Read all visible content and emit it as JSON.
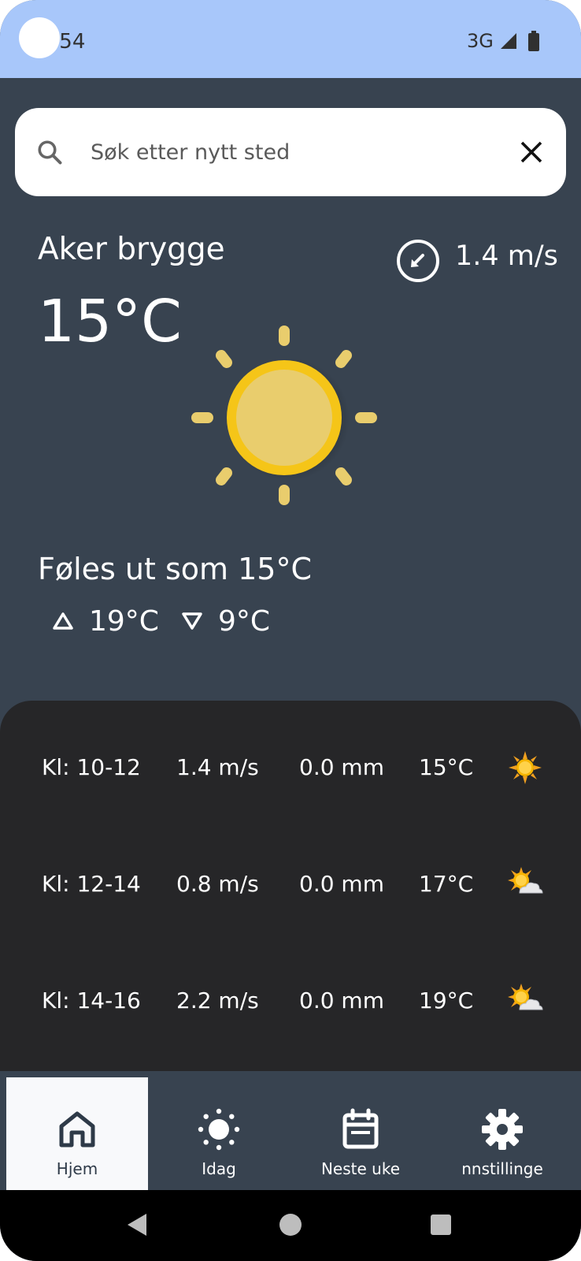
{
  "status_bar": {
    "time": "0:54",
    "network": "3G",
    "signal_icon": "cellular-signal-icon",
    "battery_icon": "battery-icon",
    "bg_color": "#a8c7fa"
  },
  "search": {
    "placeholder": "Søk etter nytt sted",
    "value": "",
    "search_icon": "search-icon",
    "clear_icon": "close-icon"
  },
  "current": {
    "location": "Aker brygge",
    "temperature": "15°C",
    "wind_speed": "1.4 m/s",
    "wind_icon": "wind-direction-icon",
    "weather_icon": "sun-icon",
    "feels_like": "Føles ut som 15°C",
    "high": "19°C",
    "low": "9°C"
  },
  "forecast": [
    {
      "time": "Kl: 10-12",
      "wind": "1.4 m/s",
      "precip": "0.0 mm",
      "temp": "15°C",
      "icon": "sunny-icon"
    },
    {
      "time": "Kl: 12-14",
      "wind": "0.8 m/s",
      "precip": "0.0 mm",
      "temp": "17°C",
      "icon": "partly-cloudy-icon"
    },
    {
      "time": "Kl: 14-16",
      "wind": "2.2 m/s",
      "precip": "0.0 mm",
      "temp": "19°C",
      "icon": "partly-cloudy-icon"
    }
  ],
  "bottom_nav": {
    "items": [
      {
        "label": "Hjem",
        "icon": "home-icon",
        "active": true
      },
      {
        "label": "Idag",
        "icon": "sun-icon",
        "active": false
      },
      {
        "label": "Neste uke",
        "icon": "calendar-icon",
        "active": false
      },
      {
        "label": "nnstillinge",
        "icon": "gear-icon",
        "active": false
      }
    ]
  },
  "colors": {
    "background": "#384350",
    "panel": "#262628",
    "accent_sun": "#f5c518",
    "text": "#ffffff"
  }
}
